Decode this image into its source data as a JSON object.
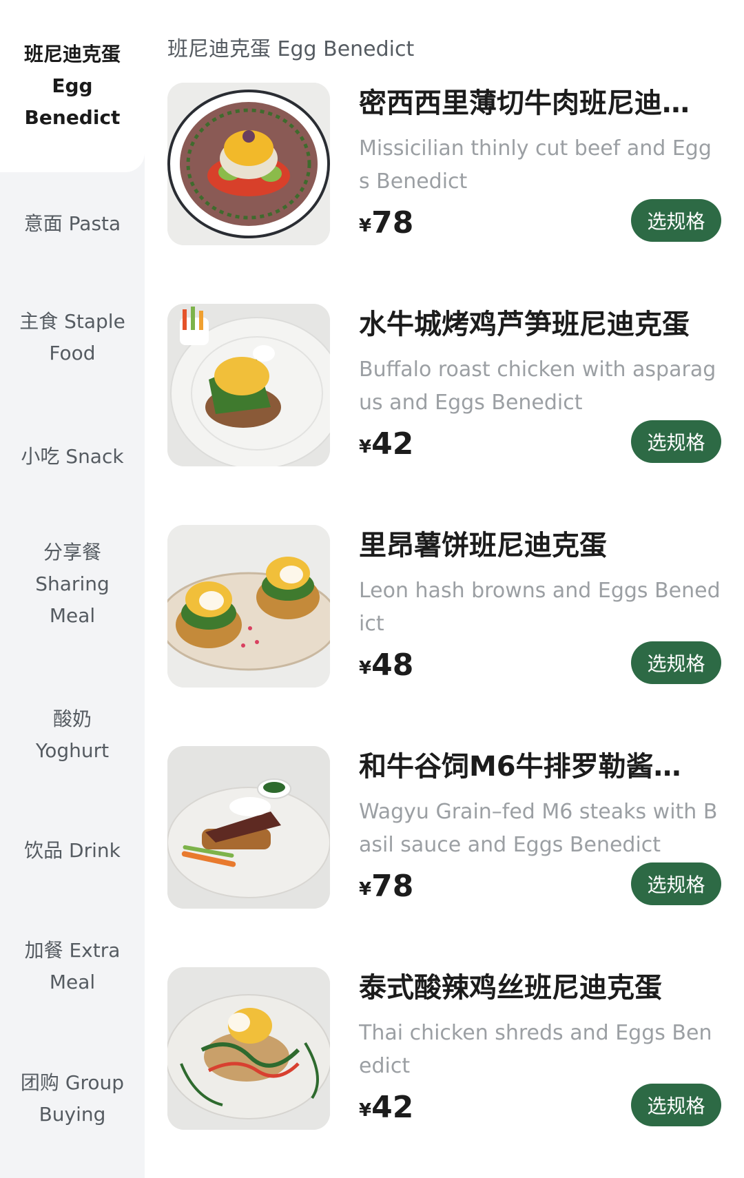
{
  "sidebar": {
    "items": [
      {
        "lines": [
          "班尼迪克蛋",
          "Egg",
          "Benedict"
        ],
        "active": true
      },
      {
        "lines": [
          "意面 Pasta"
        ],
        "active": false
      },
      {
        "lines": [
          "主食 Staple",
          "Food"
        ],
        "active": false
      },
      {
        "lines": [
          "小吃 Snack"
        ],
        "active": false
      },
      {
        "lines": [
          "分享餐",
          "Sharing",
          "Meal"
        ],
        "active": false
      },
      {
        "lines": [
          "酸奶",
          "Yoghurt"
        ],
        "active": false
      },
      {
        "lines": [
          "饮品 Drink"
        ],
        "active": false
      },
      {
        "lines": [
          "加餐 Extra",
          "Meal"
        ],
        "active": false
      },
      {
        "lines": [
          "团购 Group",
          "Buying"
        ],
        "active": false
      }
    ]
  },
  "section": {
    "title": "班尼迪克蛋 Egg Benedict"
  },
  "products": [
    {
      "name": "密西西里薄切牛肉班尼迪…",
      "desc": "Missicilian thinly cut beef and Eggs Benedict",
      "currency": "¥",
      "price": "78",
      "button": "选规格",
      "image": "beef-benedict-photo"
    },
    {
      "name": "水牛城烤鸡芦笋班尼迪克蛋",
      "desc": "Buffalo roast chicken with asparagus and Eggs Benedict",
      "currency": "¥",
      "price": "42",
      "button": "选规格",
      "image": "chicken-asparagus-benedict-photo"
    },
    {
      "name": "里昂薯饼班尼迪克蛋",
      "desc": "Leon hash browns and Eggs Benedict",
      "currency": "¥",
      "price": "48",
      "button": "选规格",
      "image": "hash-brown-benedict-photo"
    },
    {
      "name": "和牛谷饲M6牛排罗勒酱…",
      "desc": "Wagyu Grain–fed M6 steaks with Basil sauce and Eggs Benedict",
      "currency": "¥",
      "price": "78",
      "button": "选规格",
      "image": "wagyu-steak-benedict-photo"
    },
    {
      "name": "泰式酸辣鸡丝班尼迪克蛋",
      "desc": "Thai chicken shreds and Eggs Benedict",
      "currency": "¥",
      "price": "42",
      "button": "选规格",
      "image": "thai-chicken-benedict-photo"
    }
  ],
  "colors": {
    "accent": "#2d6a45",
    "sidebar_bg": "#f3f4f6",
    "desc_text": "#9b9fa3"
  }
}
